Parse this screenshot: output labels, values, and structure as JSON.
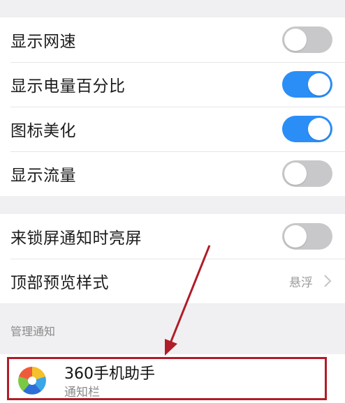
{
  "settings_group_1": [
    {
      "label": "显示网速",
      "on": false
    },
    {
      "label": "显示电量百分比",
      "on": true
    },
    {
      "label": "图标美化",
      "on": true
    },
    {
      "label": "显示流量",
      "on": false
    }
  ],
  "wake_on_lock": {
    "label": "来锁屏通知时亮屏",
    "on": false
  },
  "preview_style": {
    "label": "顶部预览样式",
    "value": "悬浮"
  },
  "manage_section": {
    "title": "管理通知"
  },
  "app": {
    "name": "360手机助手",
    "subtitle": "通知栏"
  },
  "colors": {
    "toggle_on": "#2b8ef7",
    "toggle_off": "#c8c8ca",
    "annotation": "#b01c28"
  }
}
